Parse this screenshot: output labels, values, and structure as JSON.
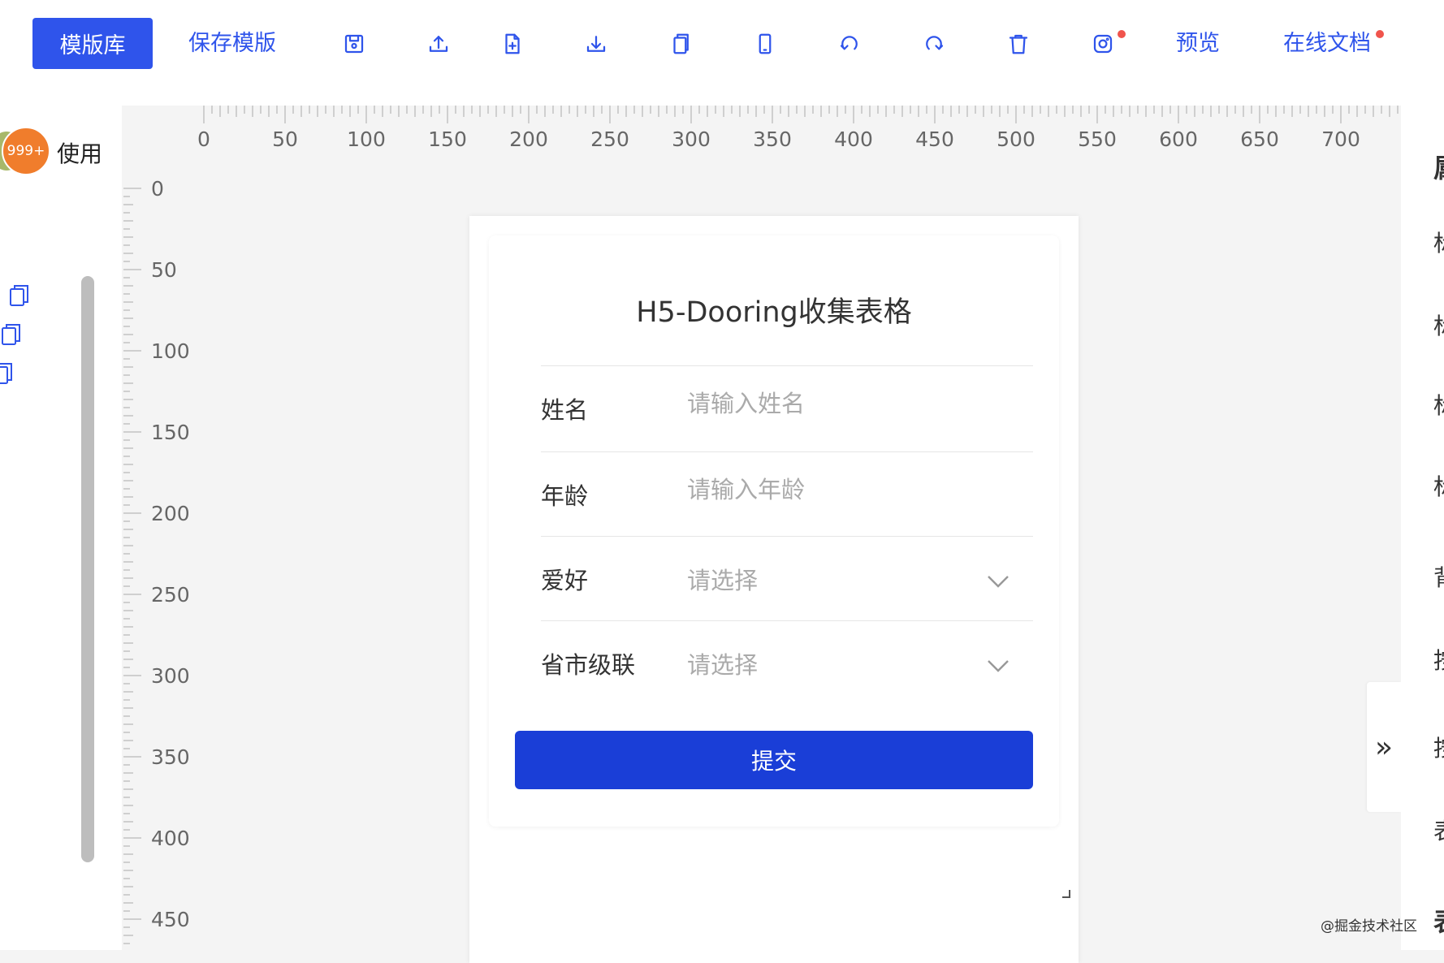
{
  "toolbar": {
    "template_library": "模版库",
    "save_template": "保存模版",
    "preview": "预览",
    "online_docs": "在线文档",
    "icons": [
      "save-icon",
      "upload-icon",
      "new-file-icon",
      "download-icon",
      "copy-icon",
      "mobile-icon",
      "undo-icon",
      "redo-icon",
      "delete-icon",
      "instagram-icon"
    ]
  },
  "left_panel": {
    "badge_count": "999+",
    "use_label": "使用"
  },
  "rulers": {
    "horizontal": [
      "0",
      "50",
      "100",
      "150",
      "200",
      "250",
      "300",
      "350",
      "400",
      "450",
      "500",
      "550",
      "600",
      "650",
      "700"
    ],
    "vertical": [
      "0",
      "50",
      "100",
      "150",
      "200",
      "250",
      "300",
      "350",
      "400",
      "450"
    ]
  },
  "form": {
    "title": "H5-Dooring收集表格",
    "fields": [
      {
        "label": "姓名",
        "placeholder": "请输入姓名"
      },
      {
        "label": "年龄",
        "placeholder": "请输入年龄"
      },
      {
        "label": "爱好",
        "placeholder": "请选择"
      },
      {
        "label": "省市级联",
        "placeholder": "请选择"
      }
    ],
    "submit_label": "提交"
  },
  "right_panel": {
    "collapse_label": "»",
    "chars": [
      "属",
      "标",
      "标",
      "标",
      "标",
      "背",
      "按",
      "按",
      "表",
      "表"
    ]
  },
  "watermark": "@掘金技术社区",
  "colors": {
    "accent": "#2f54eb",
    "submit": "#1a3ed7",
    "badge": "#f07d2c",
    "dot": "#f0544c"
  }
}
